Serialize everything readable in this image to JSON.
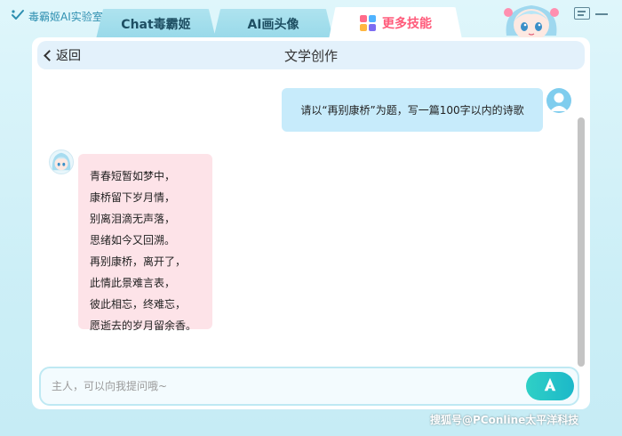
{
  "app": {
    "title": "毒霸姬AI实验室"
  },
  "tabs": [
    {
      "label": "Chat毒霸姬"
    },
    {
      "label": "AI画头像"
    },
    {
      "label": "更多技能"
    }
  ],
  "header": {
    "back_label": "返回",
    "title": "文学创作"
  },
  "messages": {
    "user": "请以“再别康桥”为题，写一篇100字以内的诗歌",
    "bot_lines": [
      "青春短暂如梦中，",
      "康桥留下岁月情，",
      "别离泪滴无声落，",
      "思绪如今又回溯。",
      "再别康桥，离开了，",
      "此情此景难言表，",
      "彼此相忘，终难忘，",
      "愿逝去的岁月留余香。"
    ]
  },
  "input": {
    "value": "",
    "placeholder": "主人，可以向我提问哦~"
  },
  "watermark": "搜狐号@PConline太平洋科技",
  "colors": {
    "accent_pink": "#ff5a7a",
    "user_bubble": "#c7ebfb",
    "bot_bubble": "#fde3e8",
    "send_button": "#1cb8c9"
  },
  "icons": {
    "brand": "heart-check-icon",
    "more_skills": "colorful-grid-icon",
    "message": "message-icon",
    "minimize": "minimize-icon",
    "back": "chevron-left-icon",
    "send": "send-a-icon"
  }
}
